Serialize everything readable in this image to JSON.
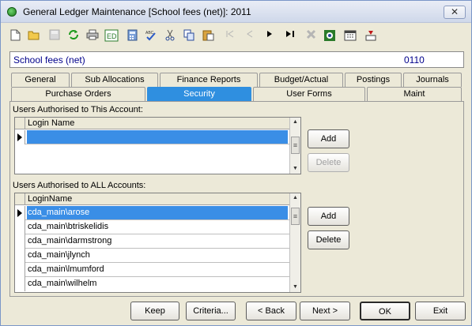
{
  "window": {
    "title": "General Ledger Maintenance  [School fees (net)]:  2011",
    "close_label": "✕"
  },
  "toolbar": {
    "icons": [
      {
        "name": "new-icon",
        "glyph": "🗋",
        "enabled": true
      },
      {
        "name": "open-icon",
        "glyph": "📂",
        "enabled": true
      },
      {
        "name": "save-icon",
        "glyph": "💾",
        "enabled": false
      },
      {
        "name": "refresh-icon",
        "glyph": "⟳",
        "enabled": true
      },
      {
        "name": "print-icon",
        "glyph": "🖶",
        "enabled": true
      },
      {
        "name": "edit-icon",
        "glyph": "ED",
        "enabled": true
      },
      {
        "name": "calculator-icon",
        "glyph": "▦",
        "enabled": true
      },
      {
        "name": "spellcheck-icon",
        "glyph": "✔",
        "enabled": true
      },
      {
        "name": "cut-icon",
        "glyph": "✂",
        "enabled": true
      },
      {
        "name": "copy-icon",
        "glyph": "⧉",
        "enabled": true
      },
      {
        "name": "paste-icon",
        "glyph": "📋",
        "enabled": true
      },
      {
        "name": "first-record-icon",
        "glyph": "|◀",
        "enabled": false
      },
      {
        "name": "previous-record-icon",
        "glyph": "◀",
        "enabled": false
      },
      {
        "name": "next-record-icon",
        "glyph": "▶",
        "enabled": true
      },
      {
        "name": "last-record-icon",
        "glyph": "▶|",
        "enabled": true
      },
      {
        "name": "delete-record-icon",
        "glyph": "✖",
        "enabled": false
      },
      {
        "name": "find-icon",
        "glyph": "⊞",
        "enabled": true
      },
      {
        "name": "calendar-icon",
        "glyph": "▤",
        "enabled": true
      },
      {
        "name": "exit-icon",
        "glyph": "⏏",
        "enabled": true
      }
    ]
  },
  "account": {
    "name": "School fees (net)",
    "code": "0110"
  },
  "tabs": {
    "row1": [
      "General",
      "Sub Allocations",
      "Finance Reports",
      "Budget/Actual",
      "Postings",
      "Journals"
    ],
    "row2": [
      "Purchase Orders",
      "Security",
      "User Forms",
      "Maint"
    ],
    "active": "Security"
  },
  "users_this": {
    "label": "Users Authorised to This Account:",
    "column": "Login Name",
    "rows": [
      ""
    ],
    "add_label": "Add",
    "delete_label": "Delete"
  },
  "users_all": {
    "label": "Users Authorised to ALL Accounts:",
    "column": "LoginName",
    "rows": [
      "cda_main\\arose",
      "cda_main\\btriskelidis",
      "cda_main\\darmstrong",
      "cda_main\\jlynch",
      "cda_main\\lmumford",
      "cda_main\\wilhelm"
    ],
    "add_label": "Add",
    "delete_label": "Delete"
  },
  "footer": {
    "keep": "Keep",
    "criteria": "Criteria...",
    "back": "< Back",
    "next": "Next >",
    "ok": "OK",
    "exit": "Exit"
  }
}
